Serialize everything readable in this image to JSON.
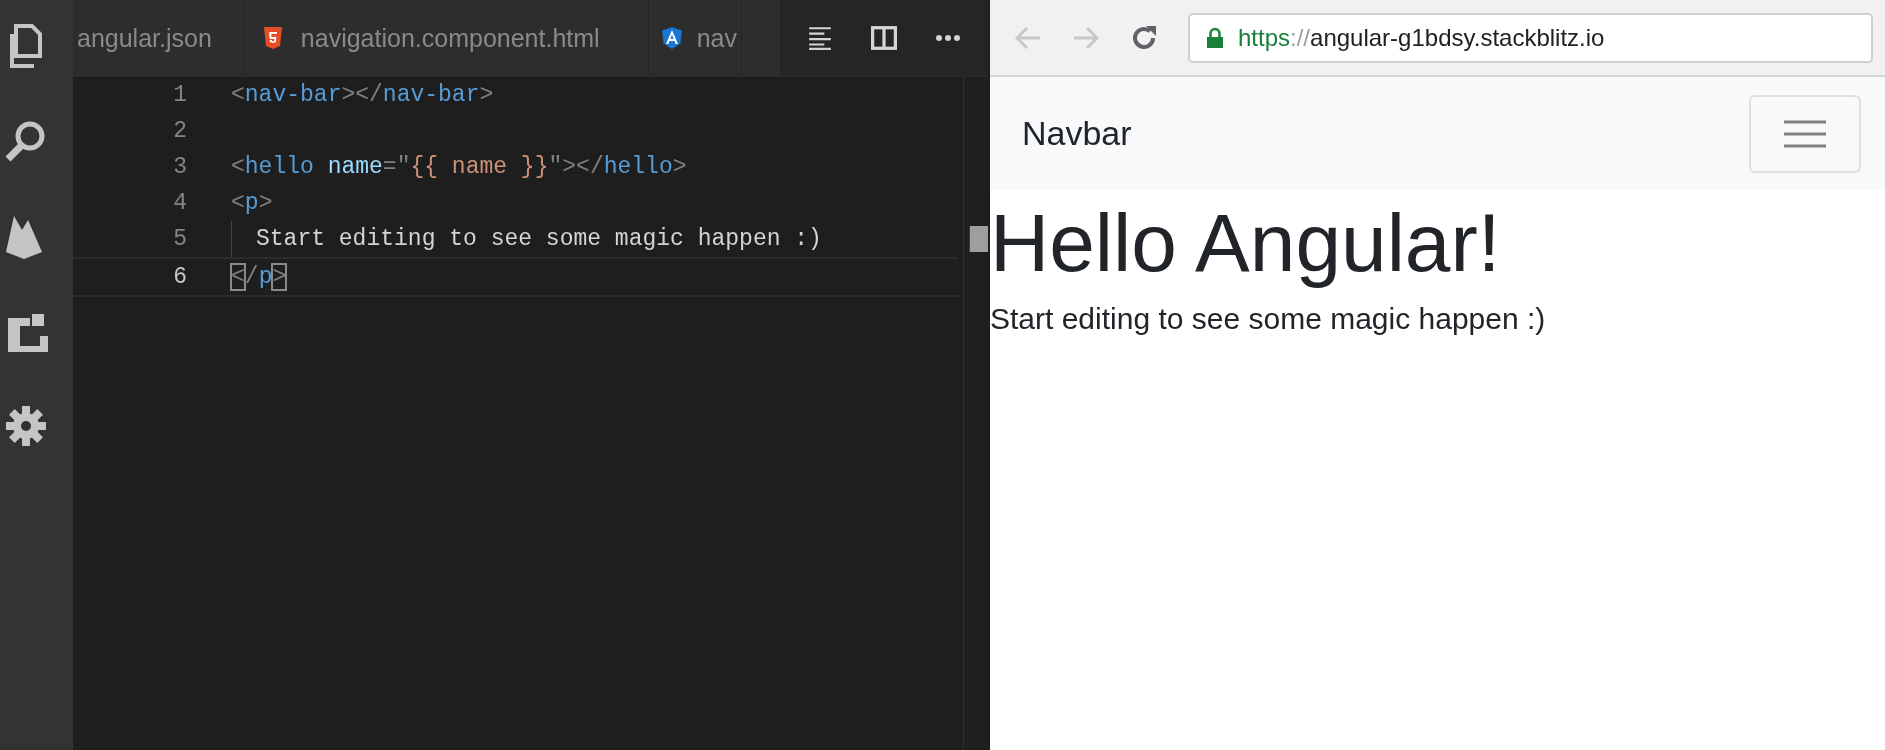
{
  "editor": {
    "tabs": [
      {
        "label": "angular.json",
        "kind": "plain"
      },
      {
        "label": "navigation.component.html",
        "kind": "html"
      },
      {
        "label": "nav",
        "kind": "angular"
      }
    ],
    "lines": [
      {
        "number": "1",
        "current": false,
        "tokens": [
          {
            "kind": "punct",
            "text": "<"
          },
          {
            "kind": "tag",
            "text": "nav-bar"
          },
          {
            "kind": "punct",
            "text": "></"
          },
          {
            "kind": "tag",
            "text": "nav-bar"
          },
          {
            "kind": "punct",
            "text": ">"
          }
        ]
      },
      {
        "number": "2",
        "current": false
      },
      {
        "number": "3",
        "current": false,
        "tokens": [
          {
            "kind": "punct",
            "text": "<"
          },
          {
            "kind": "tag",
            "text": "hello"
          },
          {
            "kind": "attr",
            "text": "name"
          },
          {
            "kind": "punct",
            "text": "=\""
          },
          {
            "kind": "string",
            "text": "{{ name }}"
          },
          {
            "kind": "punct",
            "text": "\"></"
          },
          {
            "kind": "tag",
            "text": "hello"
          },
          {
            "kind": "punct",
            "text": ">"
          }
        ]
      },
      {
        "number": "4",
        "current": false,
        "tokens": [
          {
            "kind": "punct",
            "text": "<"
          },
          {
            "kind": "tag",
            "text": "p"
          },
          {
            "kind": "punct",
            "text": ">"
          }
        ]
      },
      {
        "number": "5",
        "current": false,
        "tokens": [
          {
            "kind": "indented-text",
            "text": "Start editing to see some magic happen :)"
          }
        ]
      },
      {
        "number": "6",
        "current": true,
        "tokens": [
          {
            "kind": "match",
            "text": "<"
          },
          {
            "kind": "punct",
            "text": "/"
          },
          {
            "kind": "tag",
            "text": "p"
          },
          {
            "kind": "match",
            "text": ">"
          }
        ]
      }
    ]
  },
  "browser": {
    "nav_buttons": [
      {
        "kind": "back",
        "disabled": true
      },
      {
        "kind": "forward",
        "disabled": true
      },
      {
        "kind": "reload",
        "disabled": false
      }
    ],
    "url": {
      "scheme": "https",
      "separator": "://",
      "host": "angular-g1bdsy.stackblitz.io"
    },
    "navbar": {
      "brand": "Navbar"
    },
    "heading": "Hello Angular!",
    "paragraph": "Start editing to see some magic happen :)"
  }
}
